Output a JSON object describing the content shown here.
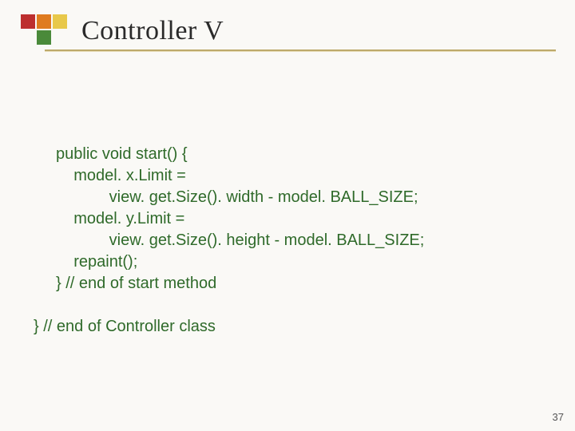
{
  "slide": {
    "title": "Controller V",
    "page_number": "37"
  },
  "code": {
    "line1": "public void start() {",
    "line2": "    model. x.Limit =",
    "line3": "            view. get.Size(). width - model. BALL_SIZE;",
    "line4": "    model. y.Limit =",
    "line5": "            view. get.Size(). height - model. BALL_SIZE;",
    "line6": "    repaint();",
    "line7": "} // end of start method",
    "blank": "",
    "line8": "} // end of Controller class"
  }
}
